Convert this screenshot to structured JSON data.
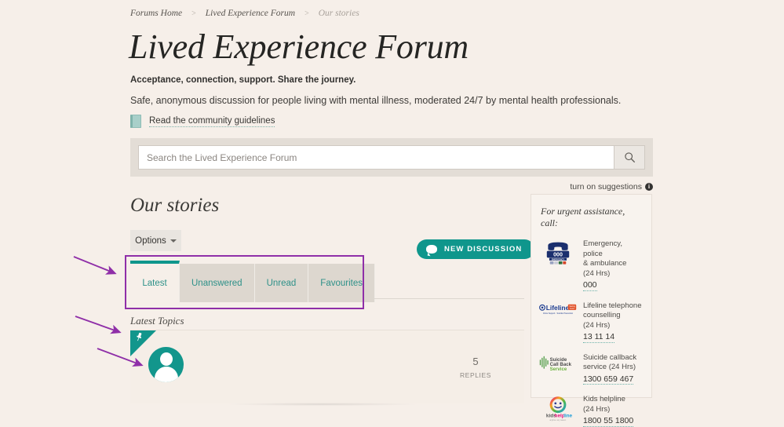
{
  "breadcrumb": {
    "items": [
      {
        "label": "Forums Home",
        "current": false
      },
      {
        "label": "Lived Experience Forum",
        "current": false
      },
      {
        "label": "Our stories",
        "current": true
      }
    ],
    "separator": ">"
  },
  "header": {
    "title": "Lived Experience Forum",
    "tagline": "Acceptance, connection, support. Share the journey.",
    "blurb": "Safe, anonymous discussion for people living with mental illness, moderated 24/7 by mental health professionals.",
    "guidelines_link": "Read the community guidelines"
  },
  "search": {
    "placeholder": "Search the Lived Experience Forum",
    "value": "",
    "icon": "search-icon",
    "suggestions_label": "turn on suggestions",
    "info_glyph": "i"
  },
  "main": {
    "section_title": "Our stories",
    "options_label": "Options",
    "new_discussion_label": "NEW DISCUSSION",
    "tabs": [
      {
        "label": "Latest",
        "active": true
      },
      {
        "label": "Unanswered",
        "active": false
      },
      {
        "label": "Unread",
        "active": false
      },
      {
        "label": "Favourites",
        "active": false
      }
    ],
    "latest_topics_label": "Latest Topics",
    "topic": {
      "pinned": true,
      "pin_glyph": "📌",
      "replies_count": "5",
      "replies_label": "REPLIES"
    }
  },
  "sidebar": {
    "title": "For urgent assistance, call:",
    "items": [
      {
        "logo": "emergency-000-logo",
        "name": "Emergency, police",
        "line2": "& ambulance",
        "hours": "(24 Hrs)",
        "phone": "000"
      },
      {
        "logo": "lifeline-logo",
        "name": "Lifeline telephone",
        "line2": "counselling",
        "hours": "(24 Hrs)",
        "phone": "13 11 14"
      },
      {
        "logo": "suicide-call-back-logo",
        "name": "Suicide callback",
        "line2": "service (24 Hrs)",
        "hours": "",
        "phone": "1300 659 467"
      },
      {
        "logo": "kids-helpline-logo",
        "name": "Kids helpline",
        "line2": "(24 Hrs)",
        "hours": "",
        "phone": "1800 55 1800"
      }
    ]
  },
  "colors": {
    "page_background": "#f6efe9",
    "accent_teal": "#0f968c",
    "tab_inactive": "#ddd7cf",
    "annotation_purple": "#8f2fa8",
    "search_band": "#e3ddd6"
  }
}
